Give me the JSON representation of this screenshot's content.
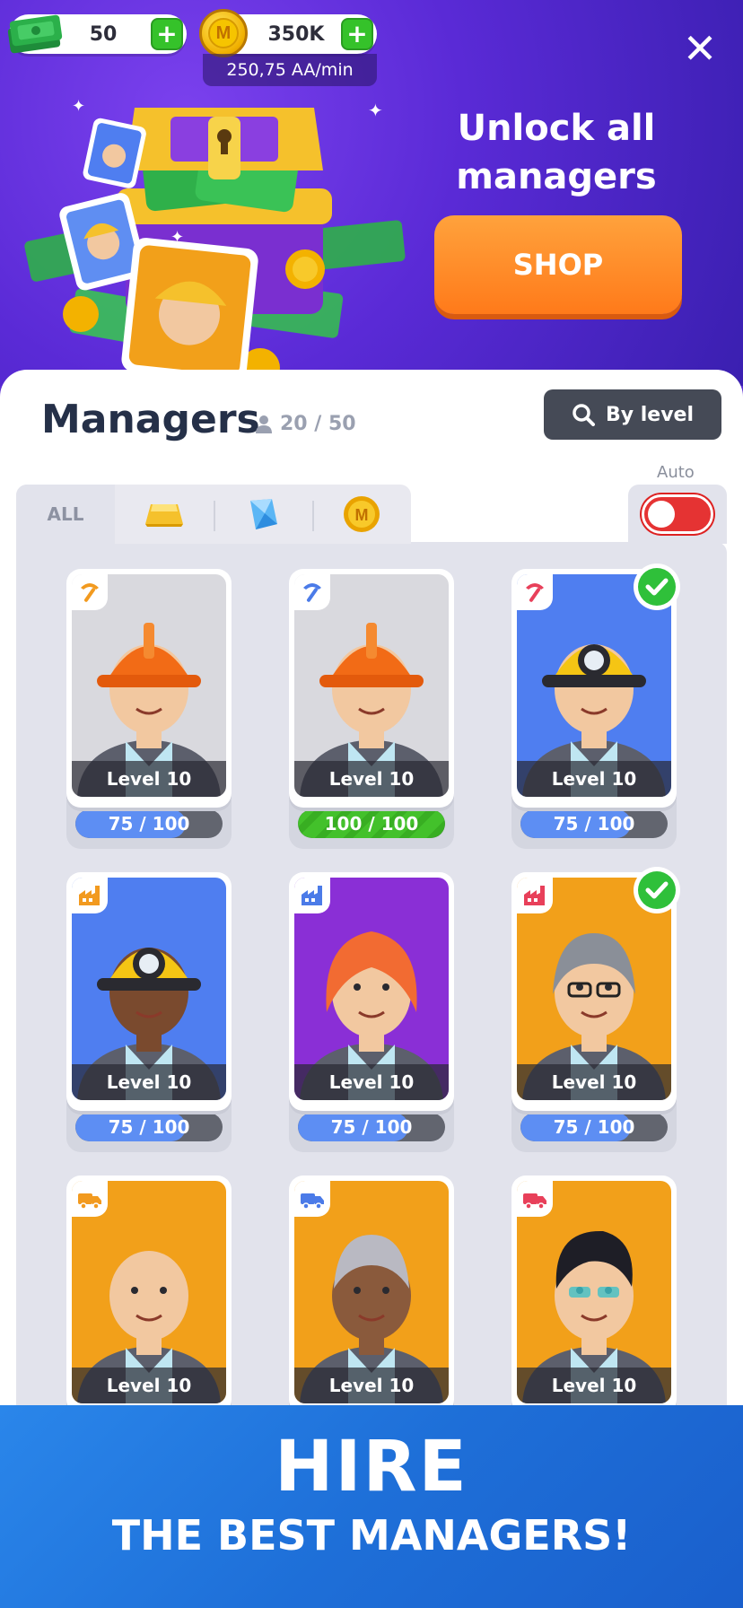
{
  "header": {
    "cash_value": "50",
    "coins_value": "350K",
    "coin_letter": "M",
    "rate": "250,75 AA/min",
    "plus_label": "+",
    "close_label": "✕"
  },
  "promo": {
    "title": "Unlock all managers",
    "shop_label": "SHOP"
  },
  "panel": {
    "title": "Managers",
    "count": "20 / 50",
    "search_label": "By level",
    "auto_label": "Auto",
    "auto_on": false
  },
  "tabs": {
    "all_label": "ALL",
    "icons": [
      "gold-bar-icon",
      "gem-icon",
      "coin-icon"
    ]
  },
  "managers": [
    {
      "level": "Level 10",
      "progress": "75 / 100",
      "progress_value": 0.75,
      "type": "pickaxe",
      "type_color": "#f29a1f",
      "bg": "#d9d9de",
      "hired": false
    },
    {
      "level": "Level 10",
      "progress": "100 / 100",
      "progress_value": 1.0,
      "type": "pickaxe",
      "type_color": "#4b7be8",
      "bg": "#d9d9de",
      "hired": false
    },
    {
      "level": "Level 10",
      "progress": "75 / 100",
      "progress_value": 0.75,
      "type": "pickaxe",
      "type_color": "#e8405a",
      "bg": "#4f7ef0",
      "hired": true
    },
    {
      "level": "Level 10",
      "progress": "75 / 100",
      "progress_value": 0.75,
      "type": "factory",
      "type_color": "#f29a1f",
      "bg": "#4f7ef0",
      "hired": false
    },
    {
      "level": "Level 10",
      "progress": "75 / 100",
      "progress_value": 0.75,
      "type": "factory",
      "type_color": "#4b7be8",
      "bg": "#8a2fd6",
      "hired": false
    },
    {
      "level": "Level 10",
      "progress": "75 / 100",
      "progress_value": 0.75,
      "type": "factory",
      "type_color": "#e8405a",
      "bg": "#f2a01a",
      "hired": true
    },
    {
      "level": "Level 10",
      "type": "truck",
      "type_color": "#f29a1f",
      "bg": "#f2a01a",
      "hired": false
    },
    {
      "level": "Level 10",
      "type": "truck",
      "type_color": "#4b7be8",
      "bg": "#f2a01a",
      "hired": false
    },
    {
      "level": "Level 10",
      "type": "truck",
      "type_color": "#e8405a",
      "bg": "#f2a01a",
      "hired": false
    }
  ],
  "bottom_promo": {
    "title": "HIRE",
    "subtitle": "THE BEST MANAGERS!"
  },
  "colors": {
    "accent_orange": "#ff8a24",
    "accent_green": "#35c22a",
    "toggle_red": "#e53333",
    "progress_blue": "#5d8ef3"
  }
}
